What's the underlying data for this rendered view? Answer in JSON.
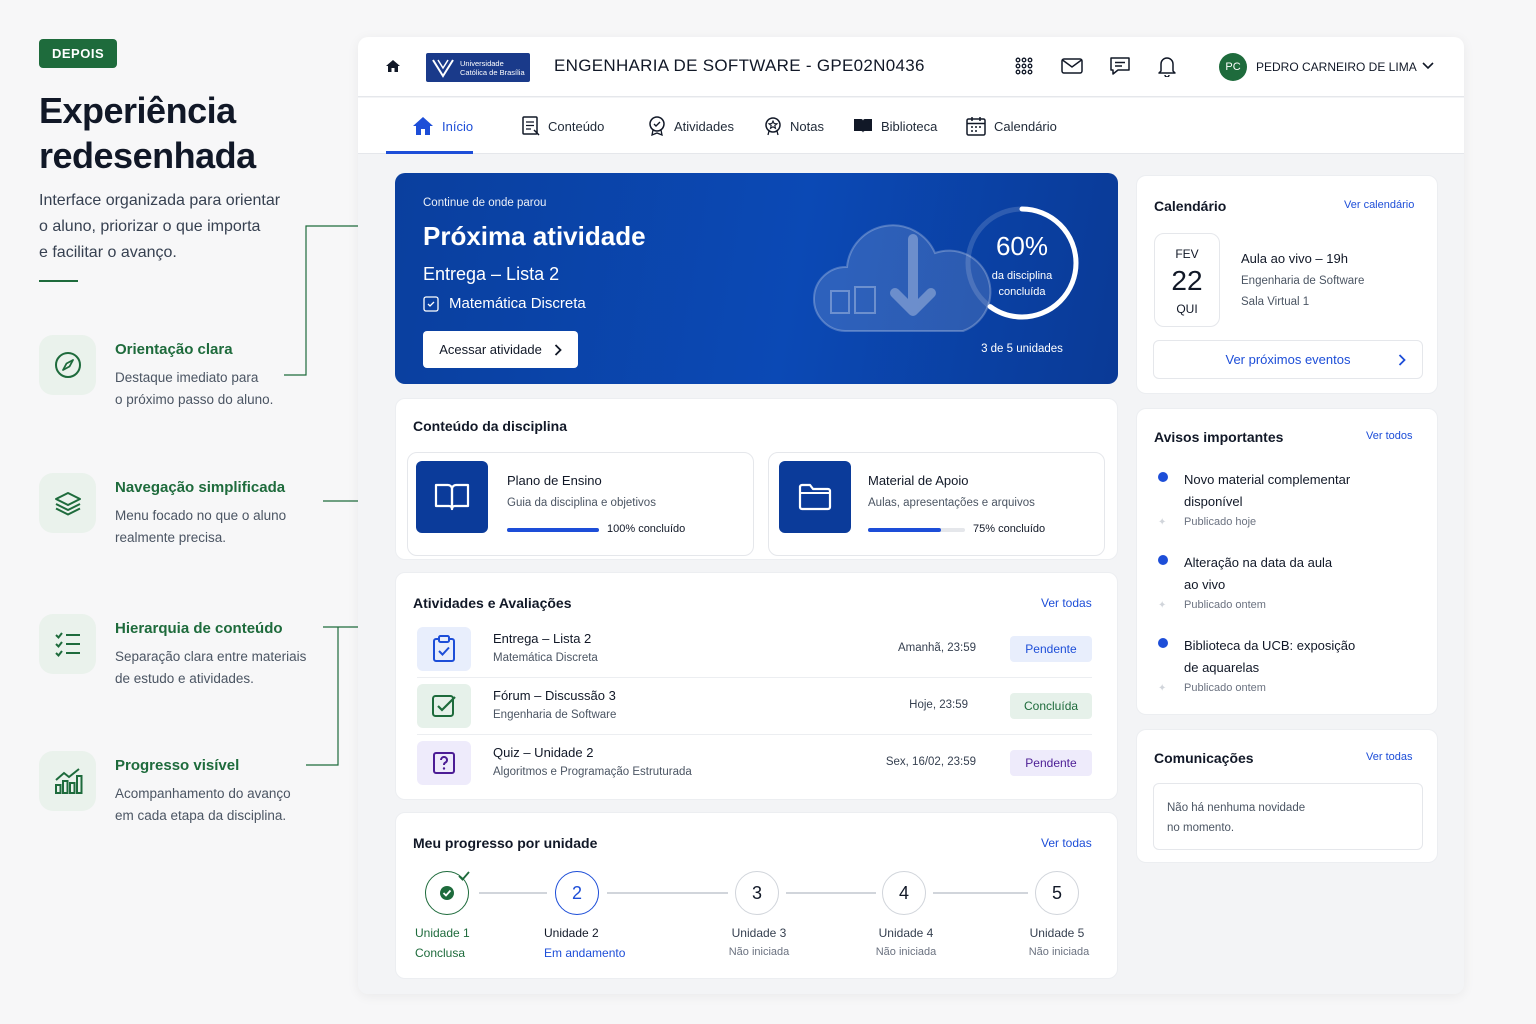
{
  "left": {
    "badge": "DEPOIS",
    "headline_1": "Experiência",
    "headline_2": "redesenhada",
    "intro_1": "Interface organizada para orientar",
    "intro_2": "o aluno, priorizar o que importa",
    "intro_3": "e facilitar o avanço.",
    "features": [
      {
        "title": "Orientação clara",
        "desc_1": "Destaque imediato para",
        "desc_2": "o próximo passo do aluno.",
        "icon": "compass-icon"
      },
      {
        "title": "Navegação simplificada",
        "desc_1": "Menu focado no que o aluno",
        "desc_2": "realmente precisa.",
        "icon": "layers-icon"
      },
      {
        "title": "Hierarquia de conteúdo",
        "desc_1": "Separação clara entre materiais",
        "desc_2": "de estudo e atividades.",
        "icon": "list-check-icon"
      },
      {
        "title": "Progresso visível",
        "desc_1": "Acompanhamento do avanço",
        "desc_2": "em cada etapa da disciplina.",
        "icon": "bar-chart-icon"
      }
    ]
  },
  "topbar": {
    "logo_1": "Universidade",
    "logo_2": "Católica de Brasília",
    "course_title": "ENGENHARIA DE SOFTWARE - GPE02N0436",
    "user_initials": "PC",
    "user_name": "PEDRO CARNEIRO DE LIMA"
  },
  "nav": [
    {
      "label": "Início",
      "icon": "home-icon"
    },
    {
      "label": "Conteúdo",
      "icon": "document-icon"
    },
    {
      "label": "Atividades",
      "icon": "badge-icon"
    },
    {
      "label": "Notas",
      "icon": "medal-icon"
    },
    {
      "label": "Biblioteca",
      "icon": "book-icon"
    },
    {
      "label": "Calendário",
      "icon": "calendar-icon"
    }
  ],
  "next": {
    "eyebrow": "Continue de onde parou",
    "title": "Próxima atividade",
    "subtitle": "Entrega – Lista 2",
    "course": "Matemática Discreta",
    "button": "Acessar atividade",
    "progress_percent": 60,
    "progress_label": "60%",
    "progress_sub_1": "da disciplina",
    "progress_sub_2": "concluída",
    "units_text": "3 de 5 unidades"
  },
  "content": {
    "title": "Conteúdo da disciplina",
    "items": [
      {
        "title": "Plano de Ensino",
        "desc": "Guia da disciplina e objetivos",
        "progress": 100,
        "progress_label": "100% concluído",
        "icon": "open-book-icon"
      },
      {
        "title": "Material de Apoio",
        "desc": "Aulas, apresentações e arquivos",
        "progress": 75,
        "progress_label": "75% concluído",
        "icon": "folder-icon"
      }
    ]
  },
  "activities": {
    "title": "Atividades e Avaliações",
    "link": "Ver todas",
    "rows": [
      {
        "title": "Entrega – Lista 2",
        "course": "Matemática Discreta",
        "due": "Amanhã, 23:59",
        "status": "Pendente",
        "icon": "clipboard-check-icon",
        "status_color": "#1d4ed8"
      },
      {
        "title": "Fórum – Discussão 3",
        "course": "Engenharia de Software",
        "due": "Hoje, 23:59",
        "status": "Concluída",
        "icon": "checkbox-icon",
        "status_color": "#1e6b3c"
      },
      {
        "title": "Quiz – Unidade 2",
        "course": "Algoritmos e Programação Estruturada",
        "due": "Sex, 16/02, 23:59",
        "status": "Pendente",
        "icon": "question-icon",
        "status_color": "#4c1d95"
      }
    ]
  },
  "progress": {
    "title": "Meu progresso por unidade",
    "link": "Ver todas",
    "units": [
      {
        "num": "",
        "label": "Unidade 1",
        "status": "Conclusa"
      },
      {
        "num": "2",
        "label": "Unidade 2",
        "status": "Em andamento"
      },
      {
        "num": "3",
        "label": "Unidade 3",
        "status": "Não iniciada"
      },
      {
        "num": "4",
        "label": "Unidade 4",
        "status": "Não iniciada"
      },
      {
        "num": "5",
        "label": "Unidade 5",
        "status": "Não iniciada"
      }
    ]
  },
  "calendar": {
    "title": "Calendário",
    "link": "Ver calendário",
    "month": "FEV",
    "day": "22",
    "weekday": "QUI",
    "event_title": "Aula ao vivo – 19h",
    "event_course": "Engenharia de Software",
    "event_room": "Sala Virtual 1",
    "button": "Ver próximos eventos"
  },
  "notices": {
    "title": "Avisos importantes",
    "link": "Ver todos",
    "items": [
      {
        "line1": "Novo material complementar",
        "line2": "disponível",
        "meta": "Publicado hoje"
      },
      {
        "line1": "Alteração na data da aula",
        "line2": "ao vivo",
        "meta": "Publicado ontem"
      },
      {
        "line1": "Biblioteca da UCB: exposição",
        "line2": "de aquarelas",
        "meta": "Publicado ontem"
      }
    ]
  },
  "comms": {
    "title": "Comunicações",
    "link": "Ver todas",
    "empty_1": "Não há nenhuma novidade",
    "empty_2": "no momento."
  },
  "colors": {
    "brand_green": "#1e6b3c",
    "brand_blue": "#1d4ed8",
    "hero_blue": "#0b49b5"
  }
}
